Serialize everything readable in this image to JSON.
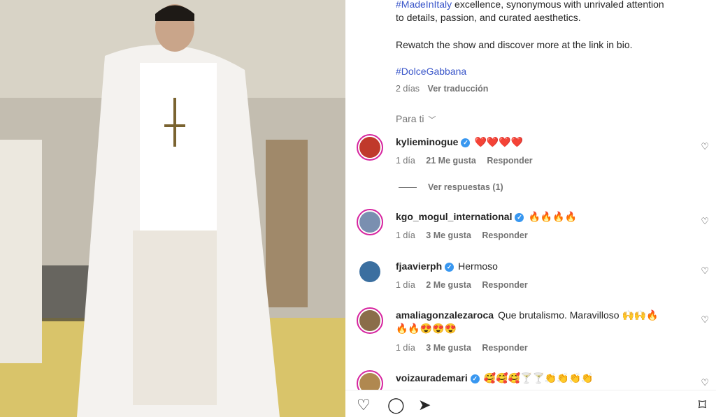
{
  "post": {
    "caption_line1_hashtag": "#MadeInItaly",
    "caption_line1_text": " excellence, synonymous with unrivaled attention",
    "caption_line2": "to details, passion, and curated aesthetics.",
    "caption_line3": "Rewatch the show and discover more at the link in bio.",
    "hashtag": "#DolceGabbana",
    "age": "2 días",
    "translate": "Ver traducción",
    "filter": "Para ti"
  },
  "comments": [
    {
      "user": "kylieminogue",
      "text": "❤️❤️❤️❤️",
      "time": "1 día",
      "likes": "21 Me gusta",
      "reply": "Responder",
      "view_replies": "Ver respuestas (1)",
      "avatar_color": "#c0392b"
    },
    {
      "user": "kgo_mogul_international",
      "text": "🔥🔥🔥🔥",
      "time": "1 día",
      "likes": "3 Me gusta",
      "reply": "Responder",
      "avatar_color": "#7a8fb0"
    },
    {
      "user": "fjaavierph",
      "text": "Hermoso",
      "time": "1 día",
      "likes": "2 Me gusta",
      "reply": "Responder",
      "avatar_color": "#3b6fa0"
    },
    {
      "user": "amaliagonzalezaroca",
      "text": "Que brutalismo. Maravilloso 🙌🙌🔥",
      "text2": "🔥🔥😍😍😍",
      "time": "1 día",
      "likes": "3 Me gusta",
      "reply": "Responder",
      "avatar_color": "#8a6d4a"
    },
    {
      "user": "voizaurademari",
      "text": "🥰🥰🥰🍸🍸👏👏👏👏",
      "avatar_color": "#b08850"
    }
  ],
  "icons": {
    "like": "heart-icon",
    "comment": "comment-icon",
    "share": "share-icon",
    "save": "bookmark-icon"
  }
}
